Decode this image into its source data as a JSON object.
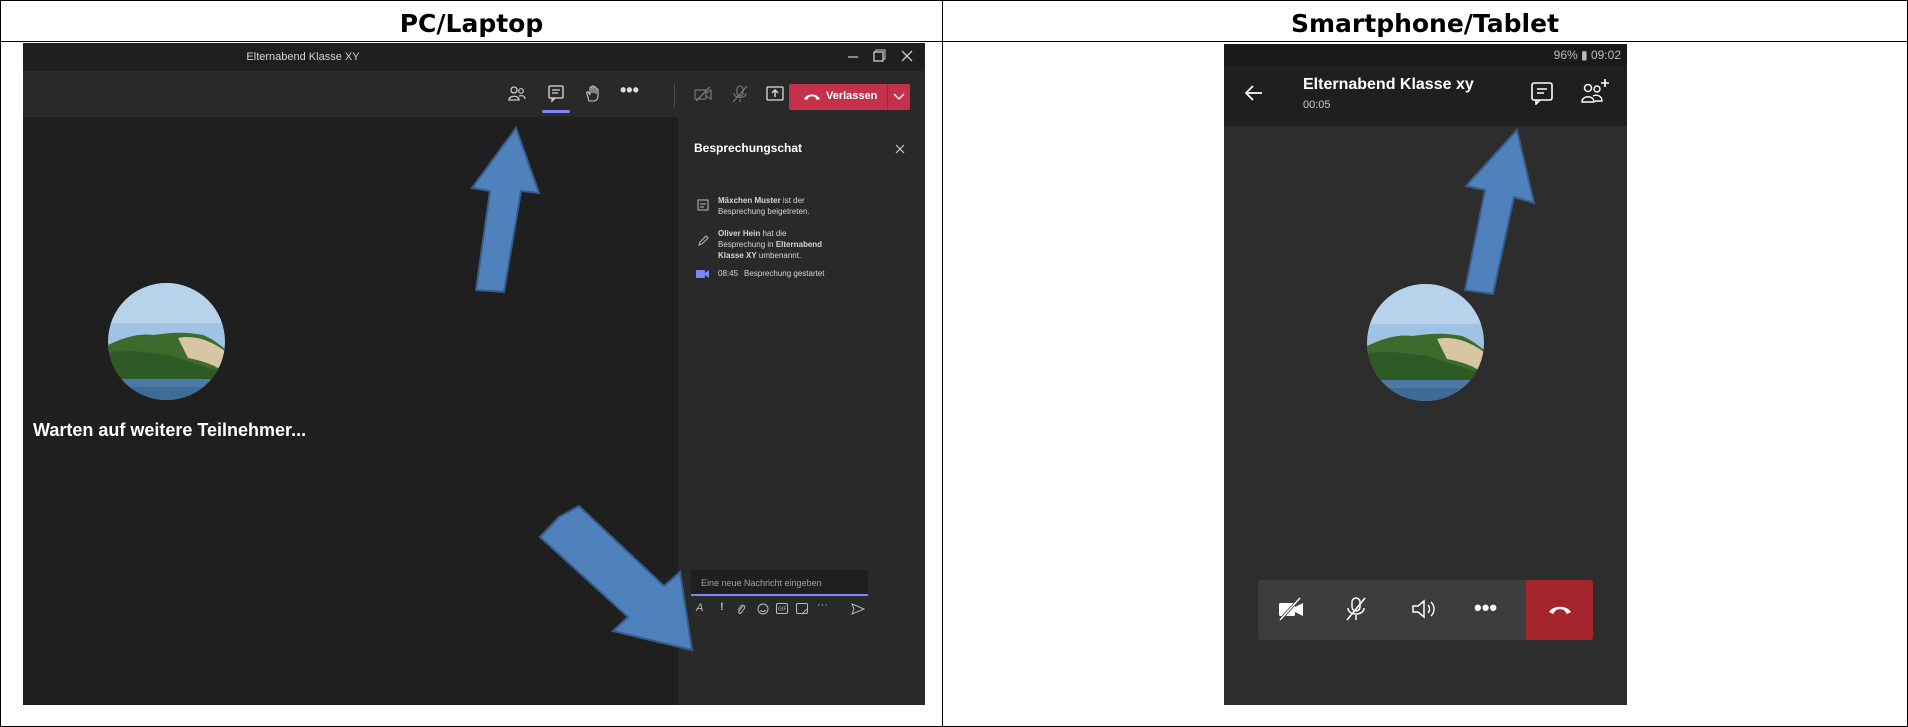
{
  "headers": {
    "left": "PC/Laptop",
    "right": "Smartphone/Tablet"
  },
  "pc": {
    "window_title": "Elternabend Klasse XY",
    "leave_label": "Verlassen",
    "waiting_text": "Warten auf weitere Teilnehmer...",
    "chat": {
      "title": "Besprechungschat",
      "events": [
        {
          "icon": "participant-joined-icon",
          "bold": "Mäxchen Muster",
          "line1": " ist der",
          "line2": "Besprechung beigetreten."
        },
        {
          "icon": "pencil-icon",
          "bold": "Oliver Hein",
          "line1": " hat die",
          "line2a": "Besprechung in ",
          "line2b": "Elternabend",
          "line3a": "Klasse XY",
          "line3b": " umbenannt."
        },
        {
          "icon": "video-camera-icon",
          "time": "08:45",
          "text": "Besprechung gestartet"
        }
      ],
      "input_placeholder": "Eine neue Nachricht eingeben"
    }
  },
  "mobile": {
    "status": "96% ▮ 09:02",
    "meeting_title": "Elternabend Klasse xy",
    "duration": "00:05"
  },
  "colors": {
    "accent": "#c4314b",
    "arrow": "#4f81bd",
    "teams_purple": "#7f85f5"
  }
}
